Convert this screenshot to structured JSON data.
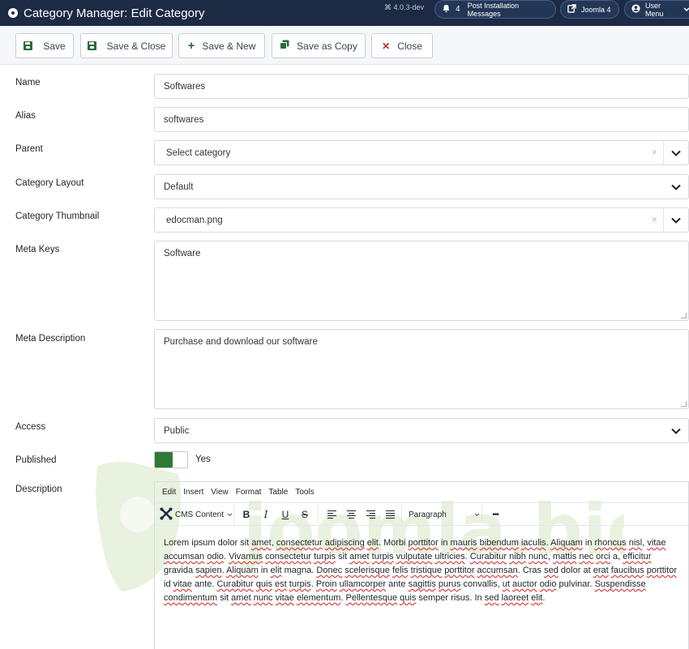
{
  "header": {
    "title": "Category Manager: Edit Category",
    "version": "⌘ 4.0.3-dev",
    "notifications_count": "4",
    "post_install_label": "Post Installation Messages",
    "joomla_label": "Joomla 4",
    "user_menu_label": "User Menu"
  },
  "toolbar": {
    "save": "Save",
    "save_close": "Save & Close",
    "save_new": "Save & New",
    "save_copy": "Save as Copy",
    "close": "Close"
  },
  "form": {
    "name": {
      "label": "Name",
      "value": "Softwares"
    },
    "alias": {
      "label": "Alias",
      "value": "softwares"
    },
    "parent": {
      "label": "Parent",
      "value": "Select category"
    },
    "layout": {
      "label": "Category Layout",
      "value": "Default"
    },
    "thumbnail": {
      "label": "Category Thumbnail",
      "value": "edocman.png"
    },
    "meta_keys": {
      "label": "Meta Keys",
      "value": "Software"
    },
    "meta_description": {
      "label": "Meta Description",
      "value": "Purchase and download our software"
    },
    "access": {
      "label": "Access",
      "value": "Public"
    },
    "published": {
      "label": "Published",
      "value": "Yes",
      "on": true
    },
    "description": {
      "label": "Description"
    }
  },
  "editor": {
    "menu": [
      "Edit",
      "Insert",
      "View",
      "Format",
      "Table",
      "Tools"
    ],
    "cms_content": "CMS Content",
    "bold": "B",
    "italic": "I",
    "underline": "U",
    "strike": "S",
    "paragraph": "Paragraph",
    "more": "•••",
    "body": "Lorem ipsum dolor sit amet, consectetur adipiscing elit. Morbi porttitor in mauris bibendum iaculis. Aliquam in rhoncus nisl, vitae accumsan odio. Vivamus consectetur turpis sit amet turpis vulputate ultricies. Curabitur nibh nunc, mattis nec orci a, efficitur gravida sapien. Aliquam in elit magna. Donec scelerisque felis tristique porttitor accumsan. Cras sed dolor at erat faucibus porttitor id vitae ante. Curabitur quis est turpis. Proin ullamcorper ante sagittis purus convallis, ut auctor odio pulvinar. Suspendisse condimentum sit amet nunc vitae elementum. Pellentesque quis semper risus. In sed laoreet elit."
  },
  "watermark": "joomla.bid",
  "colors": {
    "header_bg": "#1c2a44",
    "toolbar_bg": "#f5f7fa",
    "save_green": "#2b6a3a",
    "close_red": "#c52828",
    "switch_on": "#2f7a34"
  }
}
